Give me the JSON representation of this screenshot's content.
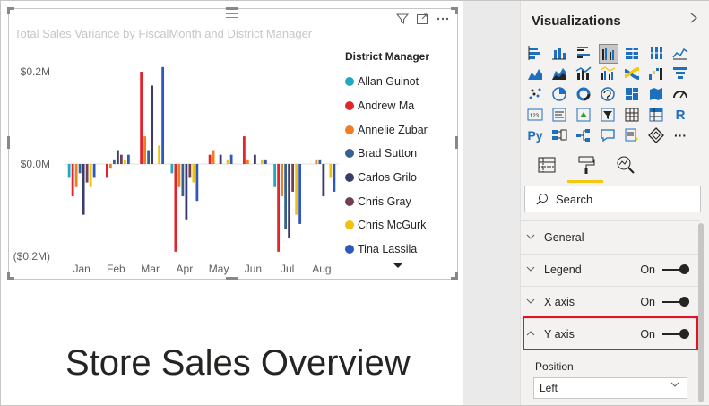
{
  "visual": {
    "title": "Total Sales Variance by FiscalMonth and District Manager",
    "header_icons": {
      "filter": "filter-icon",
      "focus": "focus-mode-icon",
      "more": "more-options-icon"
    }
  },
  "chart_data": {
    "type": "bar",
    "title": "Total Sales Variance by FiscalMonth and District Manager",
    "xlabel": "",
    "ylabel": "",
    "categories": [
      "Jan",
      "Feb",
      "Mar",
      "Apr",
      "May",
      "Jun",
      "Jul",
      "Aug"
    ],
    "yticks": [
      "$0.2M",
      "$0.0M",
      "($0.2M)"
    ],
    "ylim": [
      -0.2,
      0.2
    ],
    "legend_title": "District Manager",
    "legend_position": "right",
    "series": [
      {
        "name": "Allan Guinot",
        "color": "#1fa9c3",
        "values": [
          -0.03,
          0.0,
          0.0,
          -0.02,
          0.0,
          0.0,
          -0.05,
          0.0
        ]
      },
      {
        "name": "Andrew Ma",
        "color": "#e2242b",
        "values": [
          -0.07,
          -0.03,
          0.2,
          -0.19,
          0.02,
          0.06,
          -0.19,
          0.0
        ]
      },
      {
        "name": "Annelie Zubar",
        "color": "#f07f24",
        "values": [
          -0.05,
          -0.01,
          0.06,
          -0.05,
          0.03,
          0.01,
          -0.07,
          0.01
        ]
      },
      {
        "name": "Brad Sutton",
        "color": "#35608f",
        "values": [
          -0.02,
          0.01,
          0.03,
          -0.07,
          0.0,
          0.0,
          -0.14,
          0.01
        ]
      },
      {
        "name": "Carlos Grilo",
        "color": "#3c3b6e",
        "values": [
          -0.11,
          0.03,
          0.17,
          -0.12,
          0.02,
          0.02,
          -0.16,
          -0.07
        ]
      },
      {
        "name": "Chris Gray",
        "color": "#733f4e",
        "values": [
          -0.04,
          0.02,
          0.0,
          -0.03,
          0.0,
          0.0,
          -0.06,
          0.0
        ]
      },
      {
        "name": "Chris McGurk",
        "color": "#f1c20b",
        "values": [
          -0.05,
          0.01,
          0.04,
          -0.04,
          0.01,
          0.01,
          -0.11,
          -0.03
        ]
      },
      {
        "name": "Tina Lassila",
        "color": "#2f58be",
        "values": [
          -0.03,
          0.02,
          0.21,
          -0.08,
          0.02,
          0.01,
          -0.13,
          -0.06
        ]
      }
    ],
    "grid": false
  },
  "page": {
    "title": "Store Sales Overview"
  },
  "panel": {
    "title": "Visualizations",
    "collapse_icon": "chevron-right-icon",
    "viz_icons": [
      "stacked-bar-chart-icon",
      "stacked-column-chart-icon",
      "clustered-bar-chart-icon",
      "clustered-column-chart-icon",
      "100pct-stacked-bar-chart-icon",
      "100pct-stacked-column-chart-icon",
      "line-chart-icon",
      "area-chart-icon",
      "stacked-area-chart-icon",
      "line-and-stacked-column-chart-icon",
      "line-and-clustered-column-chart-icon",
      "ribbon-chart-icon",
      "waterfall-chart-icon",
      "funnel-chart-icon",
      "scatter-chart-icon",
      "pie-chart-icon",
      "donut-chart-icon",
      "treemap-icon",
      "map-icon",
      "filled-map-icon",
      "gauge-icon",
      "card-icon",
      "multi-row-card-icon",
      "kpi-icon",
      "slicer-icon",
      "table-icon",
      "matrix-icon",
      "r-visual-icon",
      "python-visual-icon",
      "key-influencers-icon",
      "decomposition-tree-icon",
      "qa-icon",
      "smart-narrative-icon",
      "paginated-report-icon",
      "more-visuals-icon"
    ],
    "r_label": "R",
    "py_label": "Py",
    "more_label": "···",
    "tabs": {
      "fields": "fields-icon",
      "format": "format-paint-roller-icon",
      "analytics": "analytics-icon"
    },
    "search_placeholder": "Search",
    "cards": {
      "general": {
        "label": "General"
      },
      "legend": {
        "label": "Legend",
        "state": "On"
      },
      "x_axis": {
        "label": "X axis",
        "state": "On"
      },
      "y_axis": {
        "label": "Y axis",
        "state": "On"
      }
    },
    "position": {
      "label": "Position",
      "value": "Left"
    }
  }
}
